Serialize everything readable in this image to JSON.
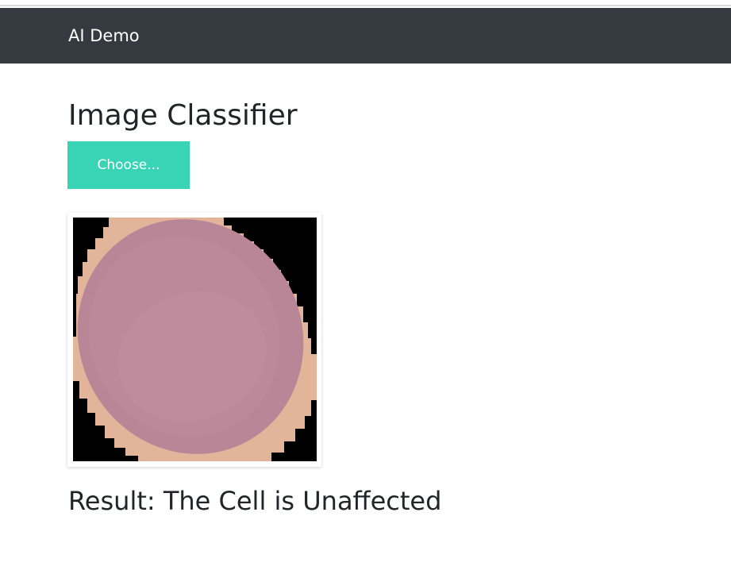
{
  "navbar": {
    "brand": "AI Demo",
    "background": "#343a40"
  },
  "main": {
    "title": "Image Classifier",
    "choose_button_label": "Choose...",
    "choose_button_color": "#39d3b5",
    "preview_image": {
      "description_icon": "blood-cell-image",
      "cell_color": "#b98698",
      "edge_color": "#e2b49a",
      "background": "#000000"
    },
    "result_text": "Result: The Cell is Unaffected"
  }
}
